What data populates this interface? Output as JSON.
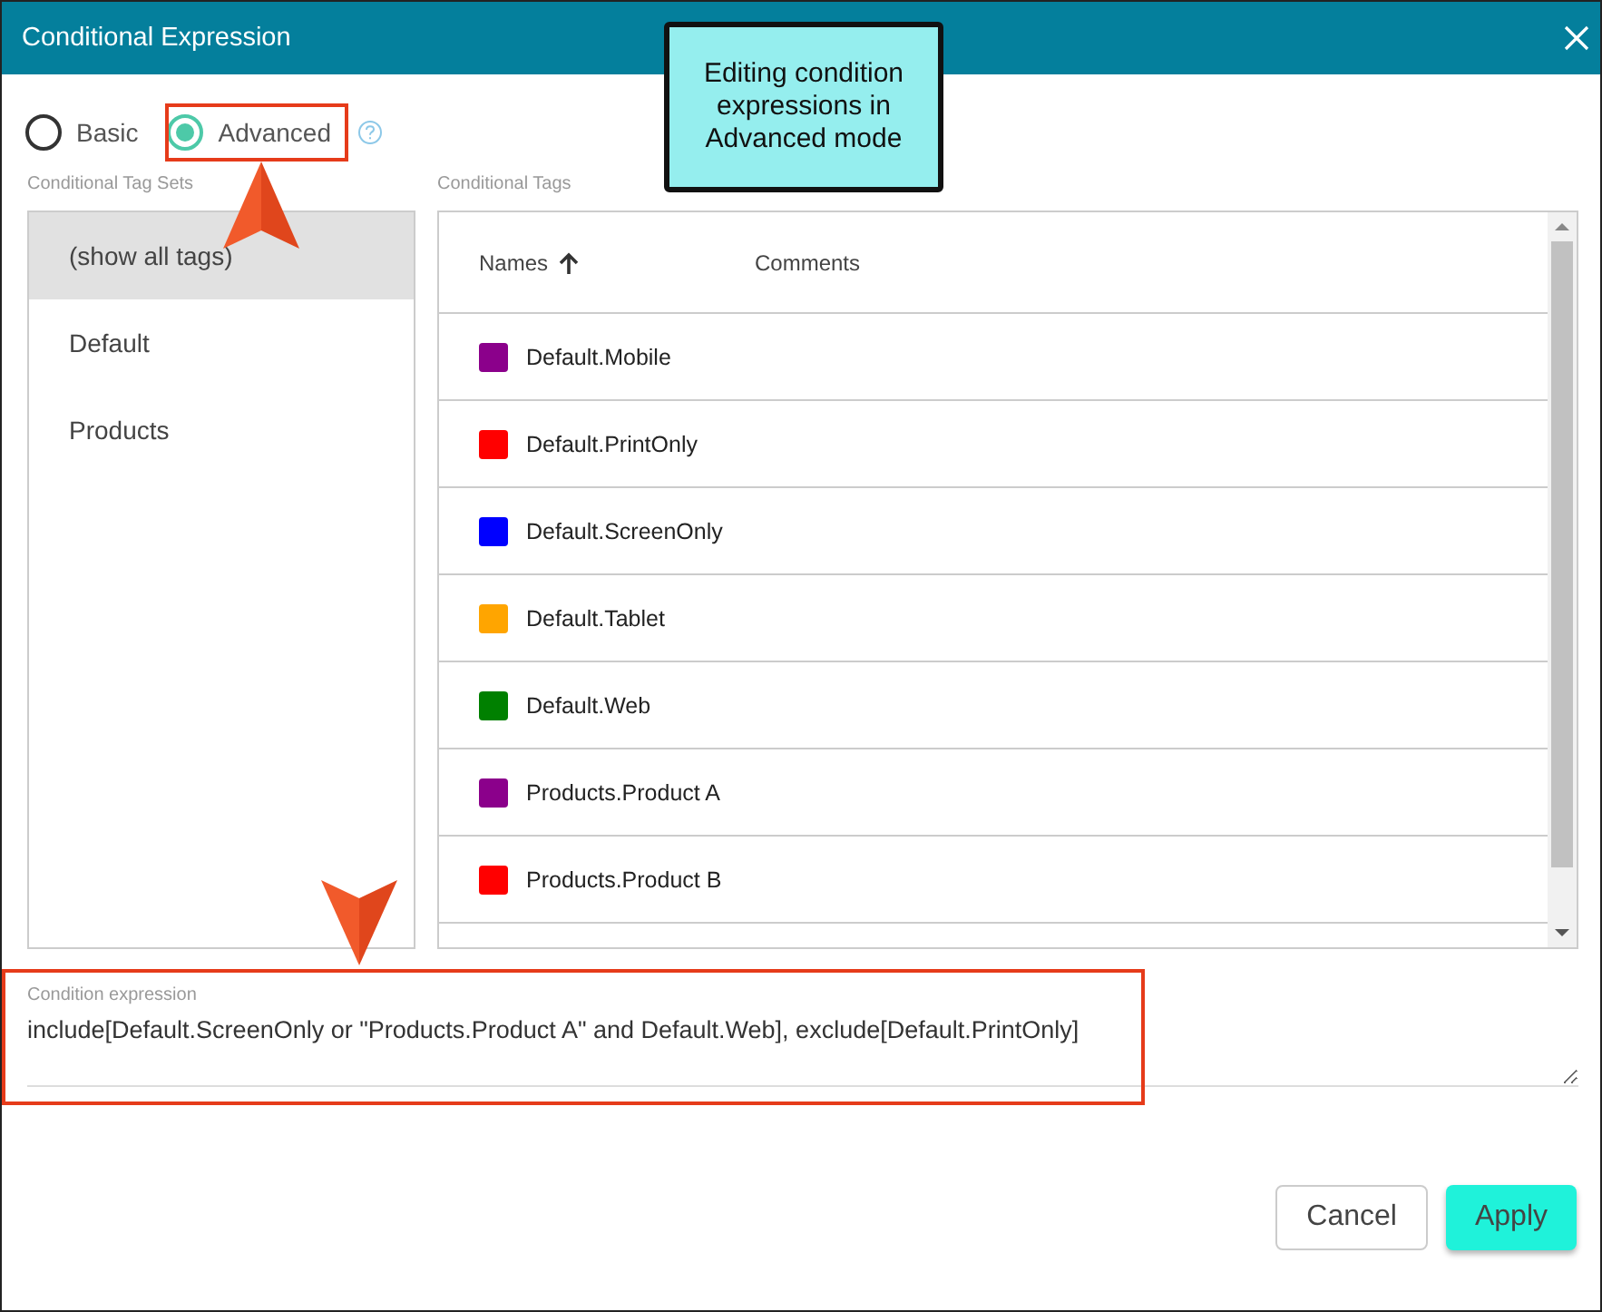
{
  "window": {
    "title": "Conditional Expression"
  },
  "modes": [
    {
      "label": "Basic",
      "selected": false
    },
    {
      "label": "Advanced",
      "selected": true
    }
  ],
  "tag_sets": {
    "label": "Conditional Tag Sets",
    "items": [
      {
        "label": "(show all tags)",
        "selected": true
      },
      {
        "label": "Default",
        "selected": false
      },
      {
        "label": "Products",
        "selected": false
      }
    ]
  },
  "tags": {
    "label": "Conditional Tags",
    "columns": [
      "Names",
      "Comments"
    ],
    "rows": [
      {
        "name": "Default.Mobile",
        "color": "#8b008b"
      },
      {
        "name": "Default.PrintOnly",
        "color": "#ff0000"
      },
      {
        "name": "Default.ScreenOnly",
        "color": "#0000ff"
      },
      {
        "name": "Default.Tablet",
        "color": "#ffa500"
      },
      {
        "name": "Default.Web",
        "color": "#008000"
      },
      {
        "name": "Products.Product A",
        "color": "#8b008b"
      },
      {
        "name": "Products.Product B",
        "color": "#ff0000"
      }
    ]
  },
  "expression": {
    "label": "Condition expression",
    "value": "include[Default.ScreenOnly or \"Products.Product A\" and Default.Web], exclude[Default.PrintOnly]"
  },
  "buttons": [
    "Cancel",
    "Apply"
  ],
  "annotation": {
    "callout": "Editing condition expressions in Advanced mode"
  }
}
